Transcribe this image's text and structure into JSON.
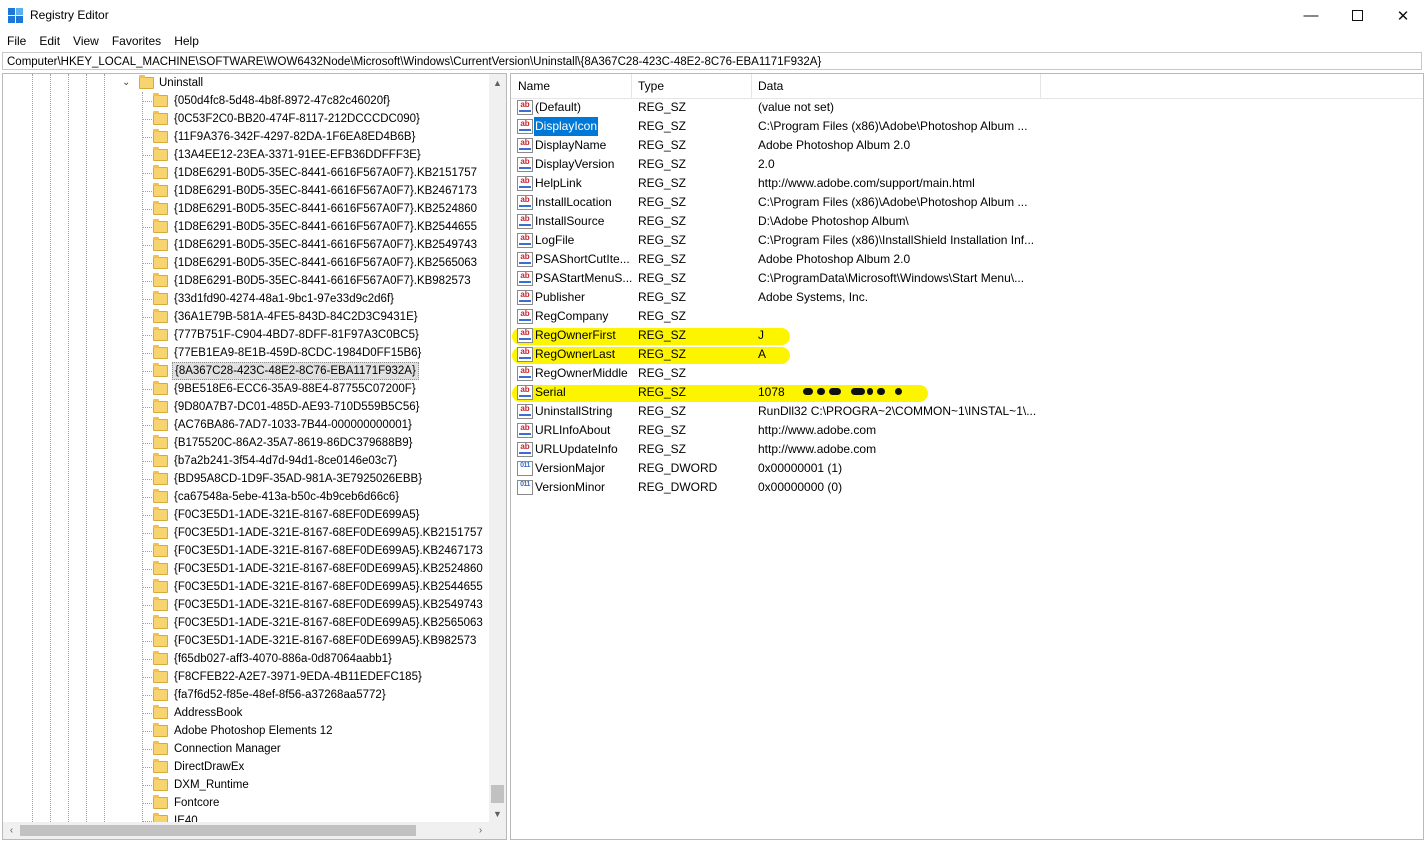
{
  "window": {
    "title": "Registry Editor"
  },
  "menu": [
    "File",
    "Edit",
    "View",
    "Favorites",
    "Help"
  ],
  "address": "Computer\\HKEY_LOCAL_MACHINE\\SOFTWARE\\WOW6432Node\\Microsoft\\Windows\\CurrentVersion\\Uninstall\\{8A367C28-423C-48E2-8C76-EBA1171F932A}",
  "tree": {
    "parent": "Uninstall",
    "selected_index": 15,
    "children": [
      "{050d4fc8-5d48-4b8f-8972-47c82c46020f}",
      "{0C53F2C0-BB20-474F-8117-212DCCCDC090}",
      "{11F9A376-342F-4297-82DA-1F6EA8ED4B6B}",
      "{13A4EE12-23EA-3371-91EE-EFB36DDFFF3E}",
      "{1D8E6291-B0D5-35EC-8441-6616F567A0F7}.KB2151757",
      "{1D8E6291-B0D5-35EC-8441-6616F567A0F7}.KB2467173",
      "{1D8E6291-B0D5-35EC-8441-6616F567A0F7}.KB2524860",
      "{1D8E6291-B0D5-35EC-8441-6616F567A0F7}.KB2544655",
      "{1D8E6291-B0D5-35EC-8441-6616F567A0F7}.KB2549743",
      "{1D8E6291-B0D5-35EC-8441-6616F567A0F7}.KB2565063",
      "{1D8E6291-B0D5-35EC-8441-6616F567A0F7}.KB982573",
      "{33d1fd90-4274-48a1-9bc1-97e33d9c2d6f}",
      "{36A1E79B-581A-4FE5-843D-84C2D3C9431E}",
      "{777B751F-C904-4BD7-8DFF-81F97A3C0BC5}",
      "{77EB1EA9-8E1B-459D-8CDC-1984D0FF15B6}",
      "{8A367C28-423C-48E2-8C76-EBA1171F932A}",
      "{9BE518E6-ECC6-35A9-88E4-87755C07200F}",
      "{9D80A7B7-DC01-485D-AE93-710D559B5C56}",
      "{AC76BA86-7AD7-1033-7B44-000000000001}",
      "{B175520C-86A2-35A7-8619-86DC379688B9}",
      "{b7a2b241-3f54-4d7d-94d1-8ce0146e03c7}",
      "{BD95A8CD-1D9F-35AD-981A-3E7925026EBB}",
      "{ca67548a-5ebe-413a-b50c-4b9ceb6d66c6}",
      "{F0C3E5D1-1ADE-321E-8167-68EF0DE699A5}",
      "{F0C3E5D1-1ADE-321E-8167-68EF0DE699A5}.KB2151757",
      "{F0C3E5D1-1ADE-321E-8167-68EF0DE699A5}.KB2467173",
      "{F0C3E5D1-1ADE-321E-8167-68EF0DE699A5}.KB2524860",
      "{F0C3E5D1-1ADE-321E-8167-68EF0DE699A5}.KB2544655",
      "{F0C3E5D1-1ADE-321E-8167-68EF0DE699A5}.KB2549743",
      "{F0C3E5D1-1ADE-321E-8167-68EF0DE699A5}.KB2565063",
      "{F0C3E5D1-1ADE-321E-8167-68EF0DE699A5}.KB982573",
      "{f65db027-aff3-4070-886a-0d87064aabb1}",
      "{F8CFEB22-A2E7-3971-9EDA-4B11EDEFC185}",
      "{fa7f6d52-f85e-48ef-8f56-a37268aa5772}",
      "AddressBook",
      "Adobe Photoshop Elements 12",
      "Connection Manager",
      "DirectDrawEx",
      "DXM_Runtime",
      "Fontcore",
      "IE40"
    ]
  },
  "columns": {
    "name": "Name",
    "type": "Type",
    "data": "Data"
  },
  "values": [
    {
      "name": "(Default)",
      "type": "REG_SZ",
      "data": "(value not set)",
      "icon": "string-value-icon"
    },
    {
      "name": "DisplayIcon",
      "type": "REG_SZ",
      "data": "C:\\Program Files (x86)\\Adobe\\Photoshop Album ...",
      "icon": "string-value-icon",
      "selected": true
    },
    {
      "name": "DisplayName",
      "type": "REG_SZ",
      "data": "Adobe Photoshop Album 2.0",
      "icon": "string-value-icon"
    },
    {
      "name": "DisplayVersion",
      "type": "REG_SZ",
      "data": "2.0",
      "icon": "string-value-icon"
    },
    {
      "name": "HelpLink",
      "type": "REG_SZ",
      "data": "http://www.adobe.com/support/main.html",
      "icon": "string-value-icon"
    },
    {
      "name": "InstallLocation",
      "type": "REG_SZ",
      "data": "C:\\Program Files (x86)\\Adobe\\Photoshop Album ...",
      "icon": "string-value-icon"
    },
    {
      "name": "InstallSource",
      "type": "REG_SZ",
      "data": "D:\\Adobe Photoshop Album\\",
      "icon": "string-value-icon"
    },
    {
      "name": "LogFile",
      "type": "REG_SZ",
      "data": "C:\\Program Files (x86)\\InstallShield Installation Inf...",
      "icon": "string-value-icon"
    },
    {
      "name": "PSAShortCutIte...",
      "type": "REG_SZ",
      "data": "Adobe Photoshop Album 2.0",
      "icon": "string-value-icon"
    },
    {
      "name": "PSAStartMenuS...",
      "type": "REG_SZ",
      "data": "C:\\ProgramData\\Microsoft\\Windows\\Start Menu\\...",
      "icon": "string-value-icon"
    },
    {
      "name": "Publisher",
      "type": "REG_SZ",
      "data": "Adobe Systems, Inc.",
      "icon": "string-value-icon"
    },
    {
      "name": "RegCompany",
      "type": "REG_SZ",
      "data": "",
      "icon": "string-value-icon"
    },
    {
      "name": "RegOwnerFirst",
      "type": "REG_SZ",
      "data": "J",
      "icon": "string-value-icon",
      "highlight": true
    },
    {
      "name": "RegOwnerLast",
      "type": "REG_SZ",
      "data": "A",
      "icon": "string-value-icon",
      "highlight": true
    },
    {
      "name": "RegOwnerMiddle",
      "type": "REG_SZ",
      "data": "",
      "icon": "string-value-icon"
    },
    {
      "name": "Serial",
      "type": "REG_SZ",
      "data": "1078",
      "icon": "string-value-icon",
      "highlight": true,
      "redacted": true
    },
    {
      "name": "UninstallString",
      "type": "REG_SZ",
      "data": "RunDll32 C:\\PROGRA~2\\COMMON~1\\INSTAL~1\\...",
      "icon": "string-value-icon"
    },
    {
      "name": "URLInfoAbout",
      "type": "REG_SZ",
      "data": "http://www.adobe.com",
      "icon": "string-value-icon"
    },
    {
      "name": "URLUpdateInfo",
      "type": "REG_SZ",
      "data": "http://www.adobe.com",
      "icon": "string-value-icon"
    },
    {
      "name": "VersionMajor",
      "type": "REG_DWORD",
      "data": "0x00000001 (1)",
      "icon": "dword-value-icon"
    },
    {
      "name": "VersionMinor",
      "type": "REG_DWORD",
      "data": "0x00000000 (0)",
      "icon": "dword-value-icon"
    }
  ],
  "colors": {
    "highlight": "#fdf500",
    "selection": "#0078d7"
  }
}
